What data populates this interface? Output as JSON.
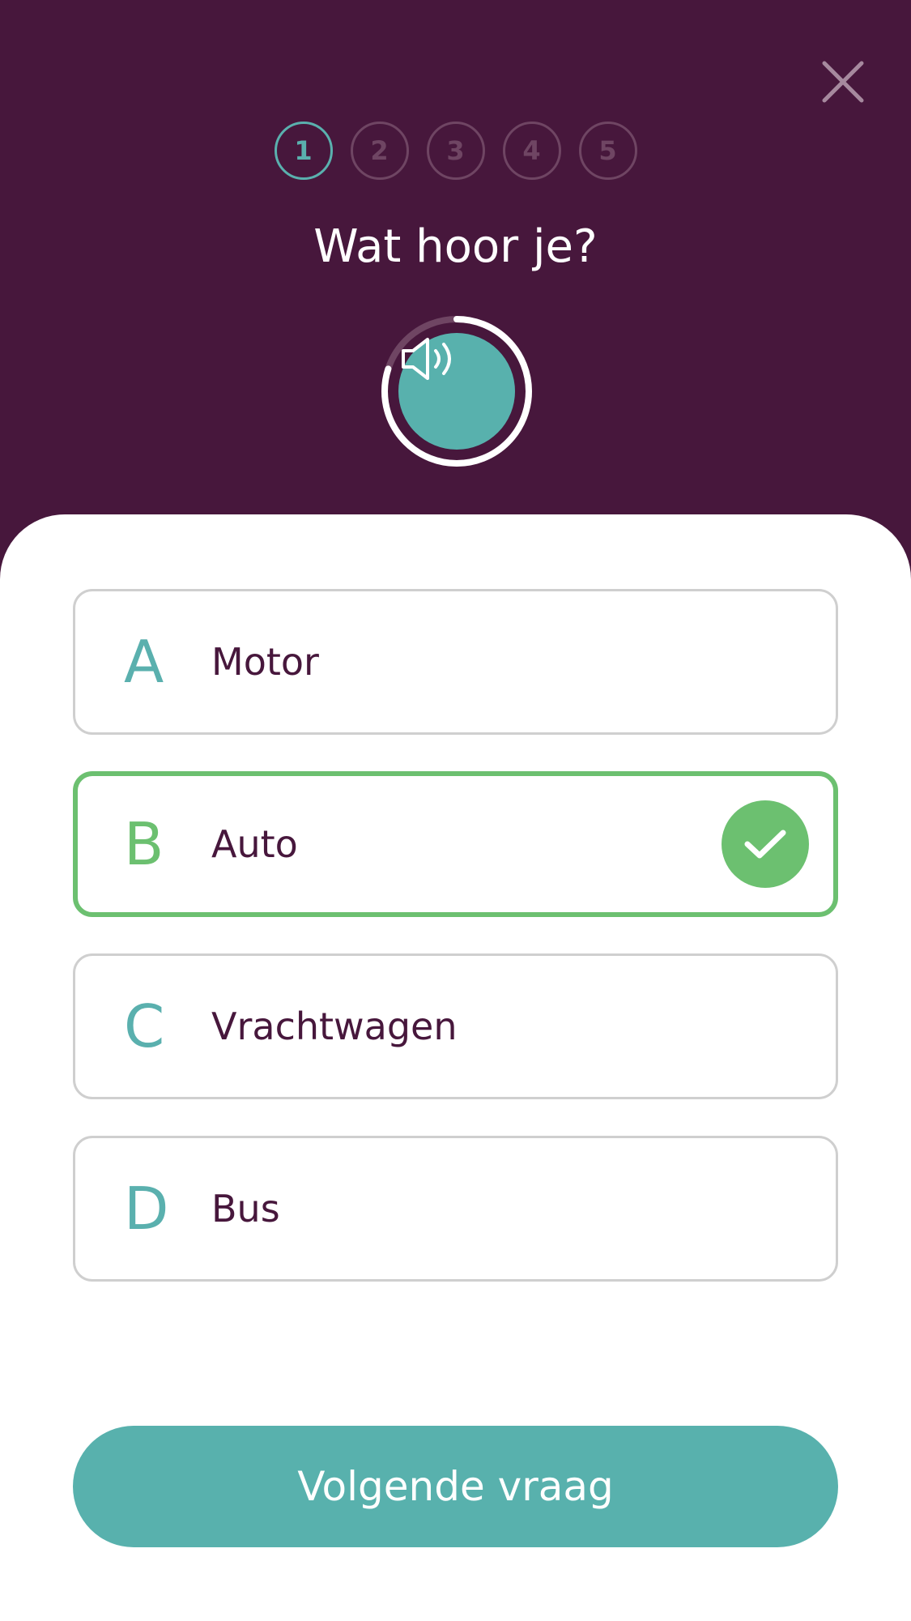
{
  "header": {
    "close_icon": "close-icon",
    "steps": [
      "1",
      "2",
      "3",
      "4",
      "5"
    ],
    "active_step": 1,
    "question": "Wat hoor je?",
    "audio_icon": "speaker-icon",
    "audio_progress": 0.8
  },
  "options": [
    {
      "letter": "A",
      "label": "Motor",
      "selected": false
    },
    {
      "letter": "B",
      "label": "Auto",
      "selected": true
    },
    {
      "letter": "C",
      "label": "Vrachtwagen",
      "selected": false
    },
    {
      "letter": "D",
      "label": "Bus",
      "selected": false
    }
  ],
  "footer": {
    "next_label": "Volgende vraag"
  },
  "colors": {
    "header_bg": "#47173c",
    "accent_teal": "#58b1ad",
    "correct_green": "#6cc070",
    "text_purple": "#47173c"
  }
}
